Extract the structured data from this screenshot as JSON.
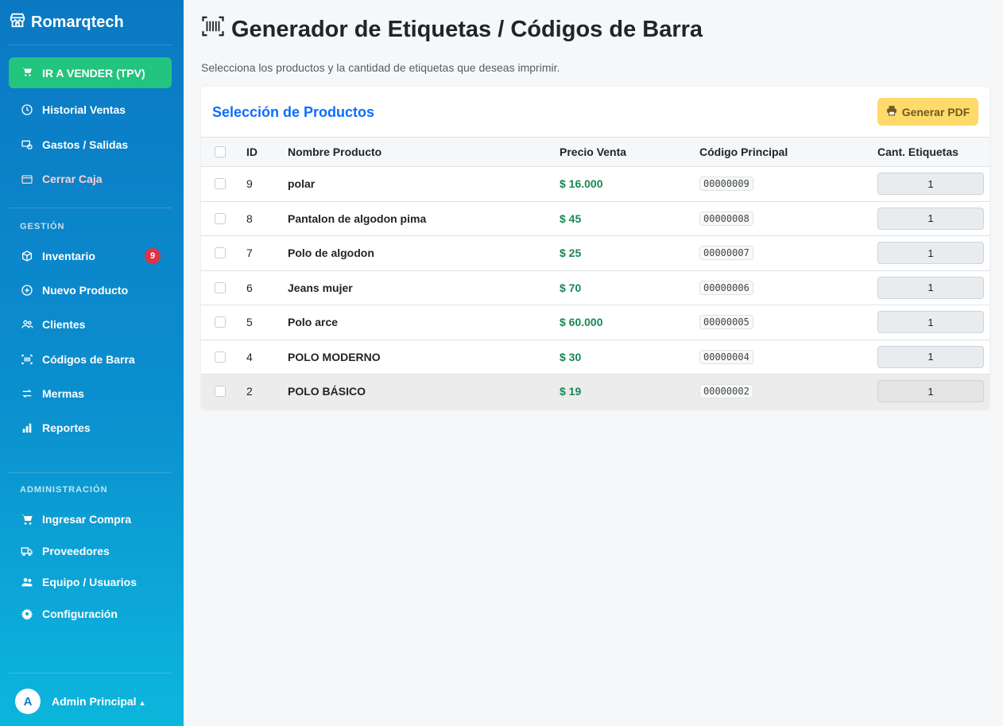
{
  "brand": {
    "name": "Romarqtech"
  },
  "sidebar": {
    "sell_button": "IR A VENDER (TPV)",
    "top_items": [
      {
        "label": "Historial Ventas",
        "icon": "clock-icon"
      },
      {
        "label": "Gastos / Salidas",
        "icon": "money-icon"
      },
      {
        "label": "Cerrar Caja",
        "icon": "wallet-icon"
      }
    ],
    "gestion_label": "GESTIÓN",
    "gestion_items": [
      {
        "label": "Inventario",
        "icon": "box-icon",
        "badge": "9"
      },
      {
        "label": "Nuevo Producto",
        "icon": "plus-circle-icon"
      },
      {
        "label": "Clientes",
        "icon": "people-icon"
      },
      {
        "label": "Códigos de Barra",
        "icon": "barcode-icon"
      },
      {
        "label": "Mermas",
        "icon": "arrows-icon"
      },
      {
        "label": "Reportes",
        "icon": "bar-chart-icon"
      }
    ],
    "admin_label": "ADMINISTRACIÓN",
    "admin_items": [
      {
        "label": "Ingresar Compra",
        "icon": "cart-icon"
      },
      {
        "label": "Proveedores",
        "icon": "truck-icon"
      },
      {
        "label": "Equipo / Usuarios",
        "icon": "users-icon"
      },
      {
        "label": "Configuración",
        "icon": "gear-icon"
      }
    ],
    "user": {
      "initial": "A",
      "name": "Admin Principal"
    }
  },
  "page": {
    "title": "Generador de Etiquetas / Códigos de Barra",
    "subtitle": "Selecciona los productos y la cantidad de etiquetas que deseas imprimir."
  },
  "card": {
    "title": "Selección de Productos",
    "pdf_button": "Generar PDF"
  },
  "table": {
    "headers": {
      "id": "ID",
      "name": "Nombre Producto",
      "price": "Precio Venta",
      "code": "Código Principal",
      "qty": "Cant. Etiquetas"
    },
    "rows": [
      {
        "id": "9",
        "name": "polar",
        "price": "$ 16.000",
        "code": "00000009",
        "qty": "1"
      },
      {
        "id": "8",
        "name": "Pantalon de algodon pima",
        "price": "$ 45",
        "code": "00000008",
        "qty": "1"
      },
      {
        "id": "7",
        "name": "Polo de algodon",
        "price": "$ 25",
        "code": "00000007",
        "qty": "1"
      },
      {
        "id": "6",
        "name": "Jeans mujer",
        "price": "$ 70",
        "code": "00000006",
        "qty": "1"
      },
      {
        "id": "5",
        "name": "Polo arce",
        "price": "$ 60.000",
        "code": "00000005",
        "qty": "1"
      },
      {
        "id": "4",
        "name": "POLO MODERNO",
        "price": "$ 30",
        "code": "00000004",
        "qty": "1"
      },
      {
        "id": "2",
        "name": "POLO BÁSICO",
        "price": "$ 19",
        "code": "00000002",
        "qty": "1"
      }
    ]
  }
}
